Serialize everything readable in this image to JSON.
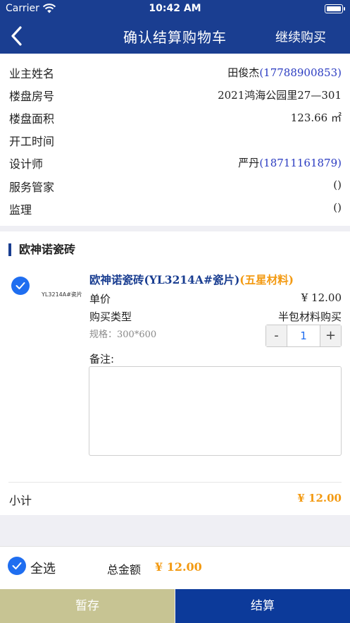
{
  "status_bar": {
    "carrier": "Carrier",
    "time": "10:42 AM"
  },
  "nav": {
    "title": "确认结算购物车",
    "continue_label": "继续购买"
  },
  "info": [
    {
      "label": "业主姓名",
      "value": "田俊杰",
      "phone": "(17788900853)"
    },
    {
      "label": "楼盘房号",
      "value": "2021鸿海公园里27—301",
      "phone": ""
    },
    {
      "label": "楼盘面积",
      "value": "123.66 ㎡",
      "phone": ""
    },
    {
      "label": "开工时间",
      "value": "",
      "phone": ""
    },
    {
      "label": "设计师",
      "value": "严丹",
      "phone": "(18711161879)"
    },
    {
      "label": "服务管家",
      "value": "()",
      "phone": ""
    },
    {
      "label": "监理",
      "value": "()",
      "phone": ""
    }
  ],
  "brand": {
    "name": "欧神诺瓷砖"
  },
  "product": {
    "thumb_text": "YL3214A#瓷片",
    "name": "欧神诺瓷砖(YL3214A#瓷片)",
    "tag": "(五星材料)",
    "price_label": "单价",
    "price": "¥ 12.00",
    "buy_type_label": "购买类型",
    "buy_type": "半包材料购买",
    "spec": "规格：300*600",
    "quantity": "1",
    "minus": "-",
    "plus": "+",
    "remark_label": "备注:",
    "remark_value": ""
  },
  "subtotal": {
    "label": "小计",
    "value": "¥ 12.00"
  },
  "footer": {
    "select_all": "全选",
    "total_label": "总金额",
    "total_value": "¥ 12.00",
    "save_label": "暂存",
    "checkout_label": "结算"
  },
  "colors": {
    "brand_blue": "#1a3e91",
    "check_blue": "#1f6ef0",
    "accent_orange": "#f39a12",
    "save_button": "#c7c493",
    "checkout_button": "#0c3a9a"
  },
  "icons": [
    "wifi-icon",
    "battery-icon",
    "back-chevron-icon",
    "checkmark-icon"
  ]
}
